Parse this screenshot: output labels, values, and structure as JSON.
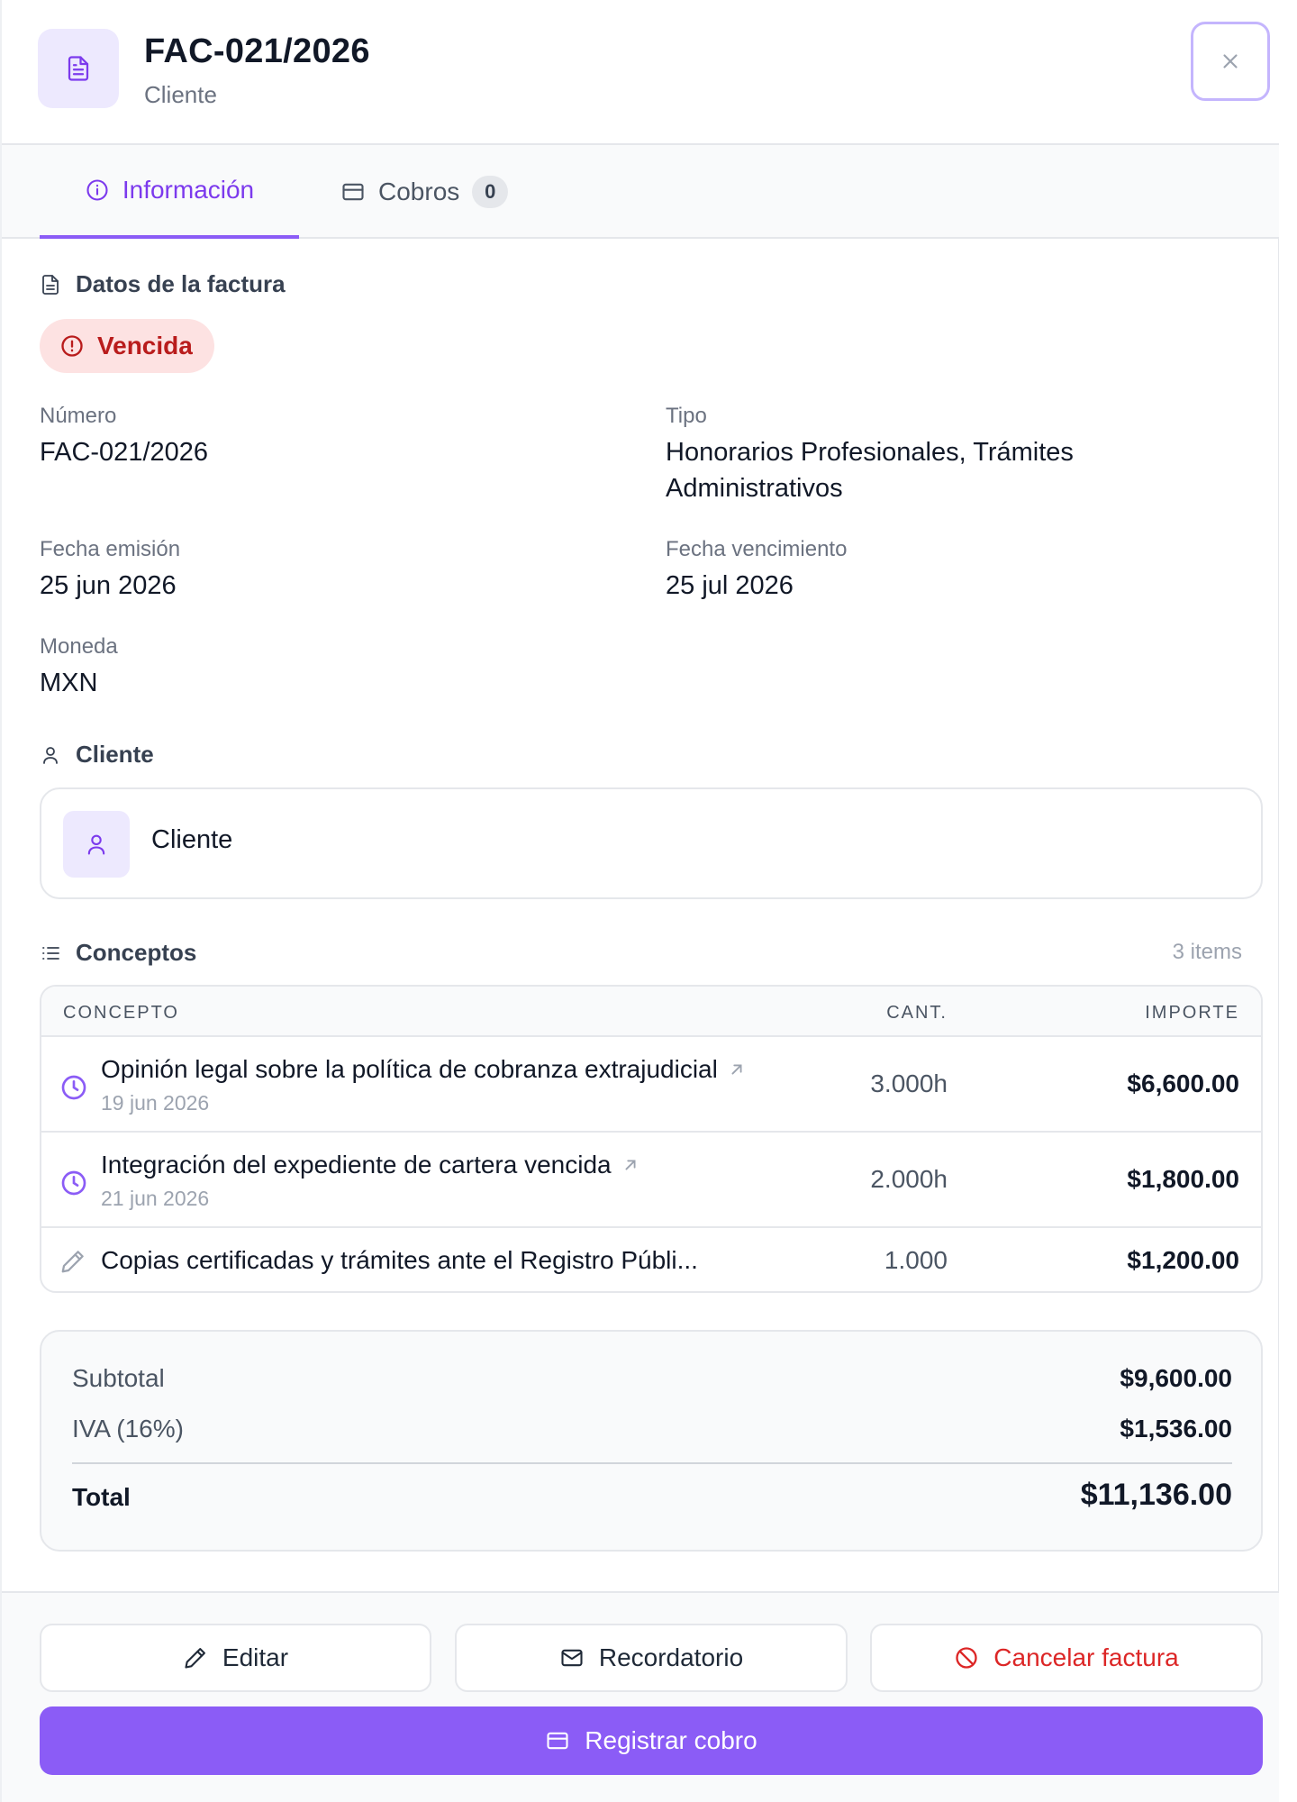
{
  "header": {
    "title": "FAC-021/2026",
    "subtitle": "Cliente"
  },
  "tabs": [
    {
      "label": "Información",
      "active": true
    },
    {
      "label": "Cobros",
      "count": "0",
      "active": false
    }
  ],
  "invoice_section": {
    "heading": "Datos de la factura",
    "status": "Vencida",
    "fields": {
      "numero": {
        "label": "Número",
        "value": "FAC-021/2026"
      },
      "tipo": {
        "label": "Tipo",
        "value_line1": "Honorarios Profesionales, Trámites",
        "value_line2": "Administrativos"
      },
      "fecha_emision": {
        "label": "Fecha emisión",
        "value": "25 jun 2026"
      },
      "fecha_vencimiento": {
        "label": "Fecha vencimiento",
        "value": "25 jul 2026"
      },
      "moneda": {
        "label": "Moneda",
        "value": "MXN"
      }
    }
  },
  "client_section": {
    "heading": "Cliente",
    "name": "Cliente"
  },
  "concepts_section": {
    "heading": "Conceptos",
    "count_label": "3 items",
    "columns": [
      "CONCEPTO",
      "CANT.",
      "IMPORTE"
    ],
    "rows": [
      {
        "icon": "clock-icon",
        "title": "Opinión legal sobre la política de cobranza extrajudicial",
        "date": "19 jun 2026",
        "qty": "3.000h",
        "amount": "$6,600.00",
        "linked": true
      },
      {
        "icon": "clock-icon",
        "title": "Integración del expediente de cartera vencida",
        "date": "21 jun 2026",
        "qty": "2.000h",
        "amount": "$1,800.00",
        "linked": true
      },
      {
        "icon": "pencil-icon",
        "title": "Copias certificadas y trámites ante el Registro Públi...",
        "date": "",
        "qty": "1.000",
        "amount": "$1,200.00",
        "linked": false
      }
    ]
  },
  "totals": {
    "subtotal_label": "Subtotal",
    "subtotal": "$9,600.00",
    "iva_label": "IVA (16%)",
    "iva": "$1,536.00",
    "total_label": "Total",
    "total": "$11,136.00"
  },
  "footer": {
    "edit_label": "Editar",
    "reminder_label": "Recordatorio",
    "cancel_label": "Cancelar factura",
    "primary_label": "Registrar cobro"
  },
  "colors": {
    "accent": "#8b5cf6",
    "accent_text": "#7c3aed",
    "danger": "#dc2626",
    "danger_bg": "#fde2e2"
  }
}
